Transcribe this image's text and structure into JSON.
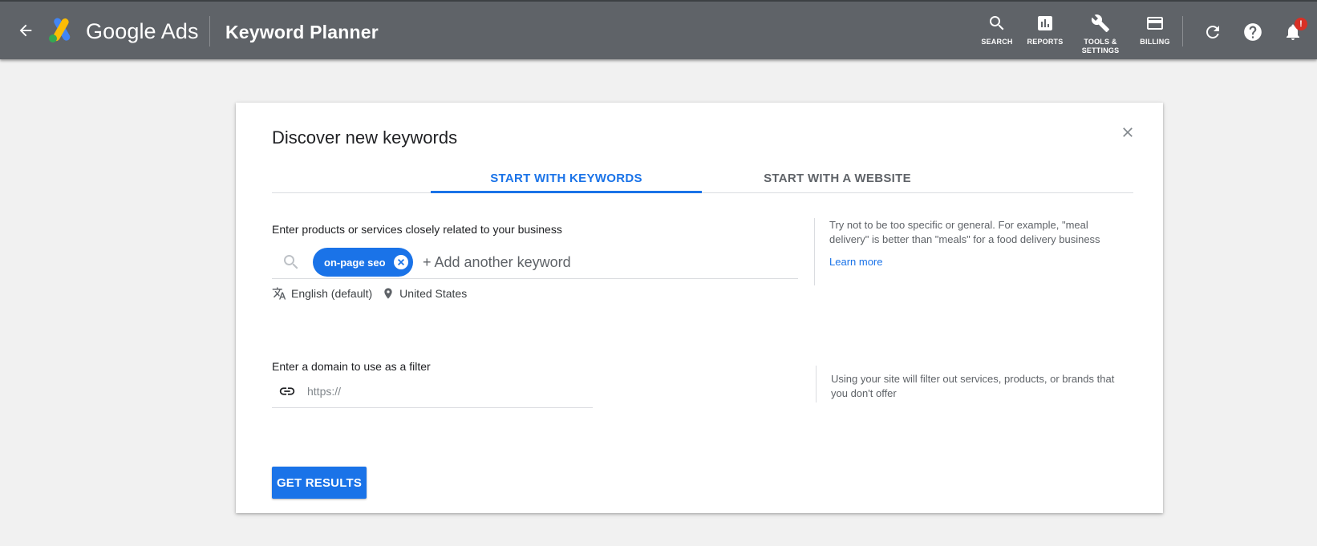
{
  "header": {
    "brand": "Google Ads",
    "page_name": "Keyword Planner",
    "nav": [
      {
        "label": "SEARCH",
        "icon": "search-icon"
      },
      {
        "label": "REPORTS",
        "icon": "reports-icon"
      },
      {
        "label": "TOOLS &\nSETTINGS",
        "icon": "wrench-icon"
      },
      {
        "label": "BILLING",
        "icon": "credit-card-icon"
      }
    ],
    "notification_badge": "!"
  },
  "card": {
    "title": "Discover new keywords",
    "tabs": [
      {
        "label": "START WITH KEYWORDS",
        "active": true
      },
      {
        "label": "START WITH A WEBSITE",
        "active": false
      }
    ],
    "keywords": {
      "label": "Enter products or services closely related to your business",
      "chip": "on-page seo",
      "placeholder": "+ Add another keyword",
      "language": "English (default)",
      "location": "United States",
      "help_text": "Try not to be too specific or general. For example, \"meal delivery\" is better than \"meals\" for a food delivery business",
      "learn_more": "Learn more"
    },
    "domain": {
      "label": "Enter a domain to use as a filter",
      "placeholder": "https://",
      "help_text": "Using your site will filter out services, products, or brands that you don't offer"
    },
    "submit_label": "GET RESULTS"
  },
  "colors": {
    "topbar": "#5f6368",
    "accent": "#1a73e8",
    "badge": "#d93025"
  }
}
